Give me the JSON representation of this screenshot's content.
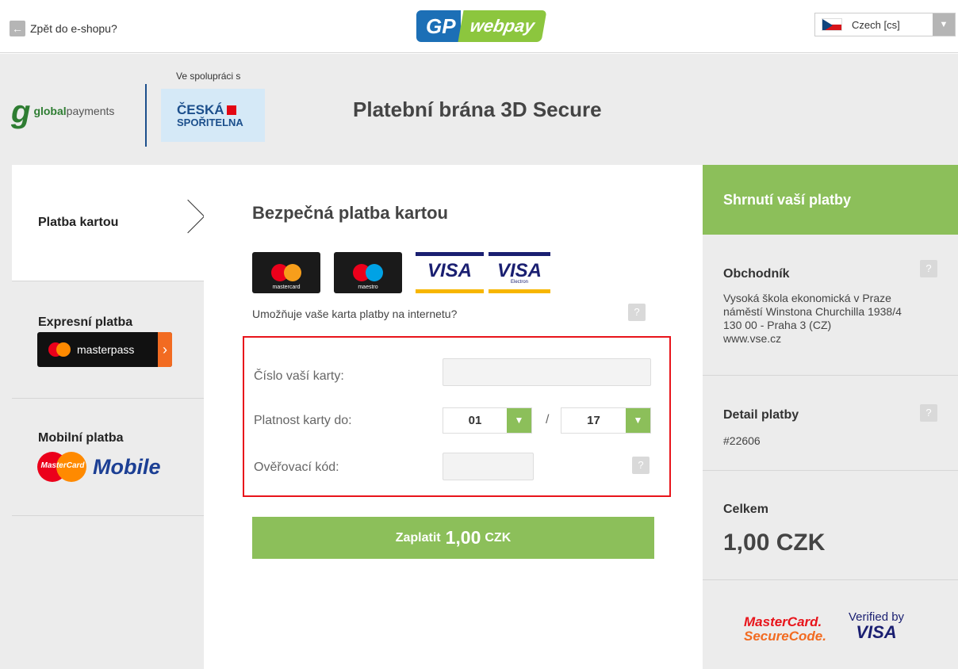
{
  "topbar": {
    "back_label": "Zpět do e-shopu?",
    "back_icon": "arrow-left-icon",
    "logo_gp": "GP",
    "logo_webpay": "webpay",
    "language": "Czech [cs]",
    "language_flag": "czech-flag-icon",
    "dropdown_icon": "▼"
  },
  "header": {
    "partner_logo_text_bold": "global",
    "partner_logo_text": "payments",
    "cooperation_label": "Ve spolupráci s",
    "bank_line1": "ČESKÁ",
    "bank_line2": "SPOŘITELNA",
    "title": "Platební brána 3D Secure"
  },
  "nav": {
    "items": [
      {
        "label": "Platba kartou"
      },
      {
        "label": "Expresní platba"
      },
      {
        "label": "Mobilní platba"
      }
    ],
    "masterpass_label": "masterpass",
    "mastercard_small": "MasterCard",
    "mobile_label": "Mobile"
  },
  "main": {
    "title": "Bezpečná platba kartou",
    "cards": [
      {
        "name": "mastercard",
        "label": "mastercard"
      },
      {
        "name": "maestro",
        "label": "maestro"
      },
      {
        "name": "visa",
        "label": "VISA"
      },
      {
        "name": "visa-electron",
        "label": "VISA",
        "sub": "Electron"
      }
    ],
    "card_question": "Umožňuje vaše karta platby na internetu?",
    "help": "?",
    "card_number_label": "Číslo vaší karty:",
    "card_number_value": "",
    "expiry_label": "Platnost karty do:",
    "expiry_month": "01",
    "expiry_year": "17",
    "expiry_separator": "/",
    "cvc_label": "Ověřovací kód:",
    "cvc_value": "",
    "pay_prefix": "Zaplatit",
    "pay_amount": "1,00",
    "pay_currency": "CZK"
  },
  "summary": {
    "title": "Shrnutí vaší platby",
    "merchant_title": "Obchodník",
    "merchant_lines": [
      "Vysoká škola ekonomická v Praze",
      "náměstí Winstona Churchilla 1938/4",
      "130 00 - Praha 3 (CZ)",
      "www.vse.cz"
    ],
    "detail_title": "Detail platby",
    "detail_value": "#22606",
    "total_title": "Celkem",
    "total_value": "1,00 CZK",
    "mc_secure_line1": "MasterCard.",
    "mc_secure_line2": "SecureCode.",
    "vbv_line1": "Verified by",
    "vbv_line2": "VISA"
  },
  "colors": {
    "accent_green": "#8cbf5a",
    "error_red": "#e8141b",
    "brand_blue": "#1c6fb6"
  }
}
